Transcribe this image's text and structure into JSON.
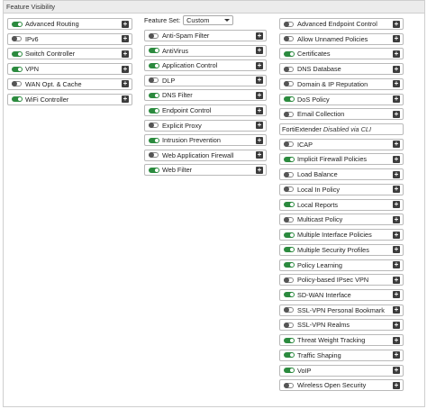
{
  "header": {
    "title": "Feature Visibility"
  },
  "feature_set": {
    "label": "Feature Set:",
    "value": "Custom"
  },
  "col1": [
    {
      "label": "Advanced Routing",
      "on": true
    },
    {
      "label": "IPv6",
      "on": false
    },
    {
      "label": "Switch Controller",
      "on": true
    },
    {
      "label": "VPN",
      "on": true
    },
    {
      "label": "WAN Opt. & Cache",
      "on": false
    },
    {
      "label": "WiFi Controller",
      "on": true
    }
  ],
  "col2": [
    {
      "label": "Anti-Spam Filter",
      "on": false
    },
    {
      "label": "AntiVirus",
      "on": true
    },
    {
      "label": "Application Control",
      "on": true
    },
    {
      "label": "DLP",
      "on": false
    },
    {
      "label": "DNS Filter",
      "on": true
    },
    {
      "label": "Endpoint Control",
      "on": true
    },
    {
      "label": "Explicit Proxy",
      "on": false
    },
    {
      "label": "Intrusion Prevention",
      "on": true
    },
    {
      "label": "Web Application Firewall",
      "on": false
    },
    {
      "label": "Web Filter",
      "on": true
    }
  ],
  "col3": [
    {
      "label": "Advanced Endpoint Control",
      "on": false
    },
    {
      "label": "Allow Unnamed Policies",
      "on": false
    },
    {
      "label": "Certificates",
      "on": true
    },
    {
      "label": "DNS Database",
      "on": false
    },
    {
      "label": "Domain & IP Reputation",
      "on": false
    },
    {
      "label": "DoS Policy",
      "on": true
    },
    {
      "label": "Email Collection",
      "on": false
    },
    {
      "label": "FortiExtender",
      "note": "Disabled via CLI",
      "static": true
    },
    {
      "label": "ICAP",
      "on": false
    },
    {
      "label": "Implicit Firewall Policies",
      "on": true
    },
    {
      "label": "Load Balance",
      "on": false
    },
    {
      "label": "Local In Policy",
      "on": false
    },
    {
      "label": "Local Reports",
      "on": true
    },
    {
      "label": "Multicast Policy",
      "on": false
    },
    {
      "label": "Multiple Interface Policies",
      "on": true
    },
    {
      "label": "Multiple Security Profiles",
      "on": true
    },
    {
      "label": "Policy Learning",
      "on": true
    },
    {
      "label": "Policy-based IPsec VPN",
      "on": false
    },
    {
      "label": "SD-WAN Interface",
      "on": true
    },
    {
      "label": "SSL-VPN Personal Bookmark",
      "on": false
    },
    {
      "label": "SSL-VPN Realms",
      "on": false
    },
    {
      "label": "Threat Weight Tracking",
      "on": true
    },
    {
      "label": "Traffic Shaping",
      "on": true
    },
    {
      "label": "VoIP",
      "on": true
    },
    {
      "label": "Wireless Open Security",
      "on": false
    }
  ]
}
